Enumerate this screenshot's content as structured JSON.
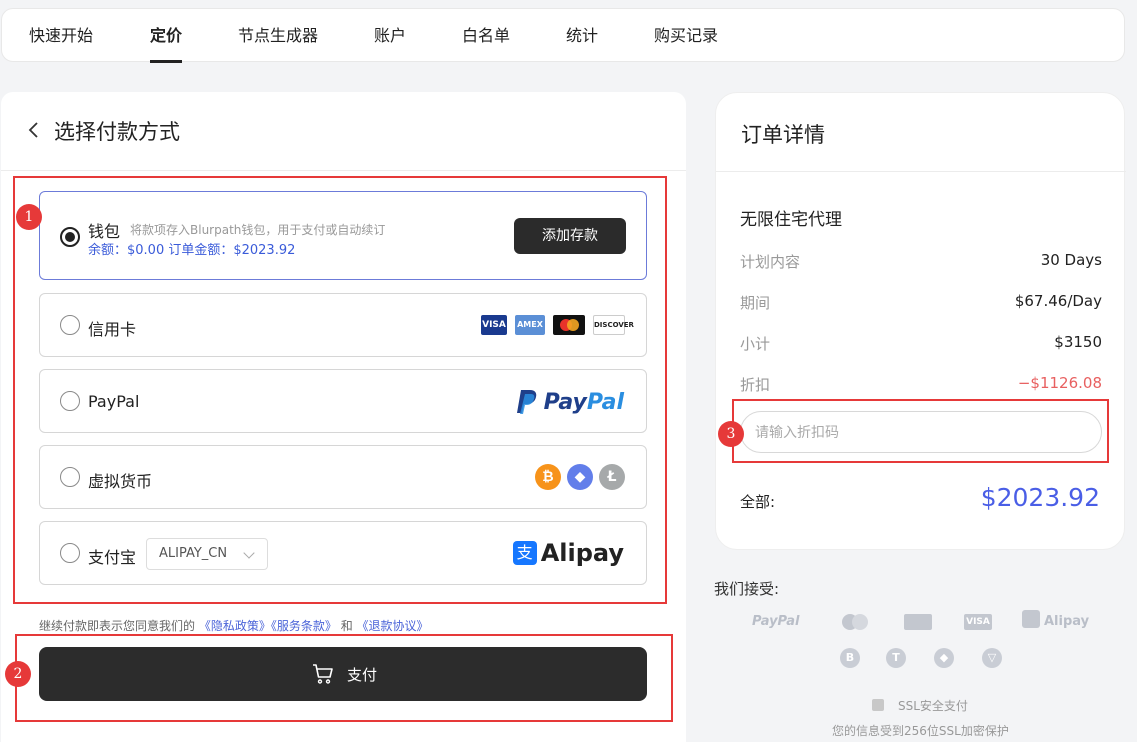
{
  "nav": {
    "tabs": [
      "快速开始",
      "定价",
      "节点生成器",
      "账户",
      "白名单",
      "统计",
      "购买记录"
    ],
    "active": "定价"
  },
  "left": {
    "title": "选择付款方式",
    "wallet": {
      "label": "钱包",
      "note": "将款项存入Blurpath钱包，用于支付或自动续订",
      "balance_line": "余额：$0.00    订单金额：$2023.92",
      "button": "添加存款",
      "selected": true
    },
    "credit": {
      "label": "信用卡",
      "badges": [
        "VISA",
        "AMEX",
        "mastercard",
        "DISCOVER"
      ]
    },
    "paypal": {
      "label": "PayPal",
      "logo_text": "PayPal"
    },
    "crypto": {
      "label": "虚拟货币",
      "icons": [
        "bitcoin-icon",
        "ethereum-icon",
        "litecoin-icon"
      ]
    },
    "alipay": {
      "label": "支付宝",
      "select_value": "ALIPAY_CN",
      "logo_mark": "支",
      "logo_text": "Alipay"
    },
    "agreement": {
      "prefix": "继续付款即表示您同意我们的",
      "privacy": "《隐私政策》",
      "terms": "《服务条款》",
      "and": "和",
      "refund": "《退款协议》"
    },
    "pay_button": "支付"
  },
  "order": {
    "title": "订单详情",
    "product": "无限住宅代理",
    "rows": [
      {
        "key": "计划内容",
        "value": "30 Days"
      },
      {
        "key": "期间",
        "value": "$67.46/Day"
      },
      {
        "key": "小计",
        "value": "$3150"
      },
      {
        "key": "折扣",
        "value": "−$1126.08"
      }
    ],
    "coupon_placeholder": "请输入折扣码",
    "total_label": "全部:",
    "total_value": "$2023.92"
  },
  "accept": {
    "title": "我们接受:",
    "methods": [
      "PayPal",
      "VISA",
      "Alipay"
    ],
    "coins": [
      "B",
      "T",
      "◆",
      "▽"
    ],
    "ssl": "SSL安全支付",
    "ssl_note": "您的信息受到256位SSL加密保护"
  },
  "annotations": [
    "1",
    "2",
    "3"
  ],
  "colors": {
    "accent": "#4a5ee6",
    "link": "#4a63d8",
    "discount": "#e86060",
    "annotation": "#e63939",
    "dark_button": "#2c2c2c"
  }
}
